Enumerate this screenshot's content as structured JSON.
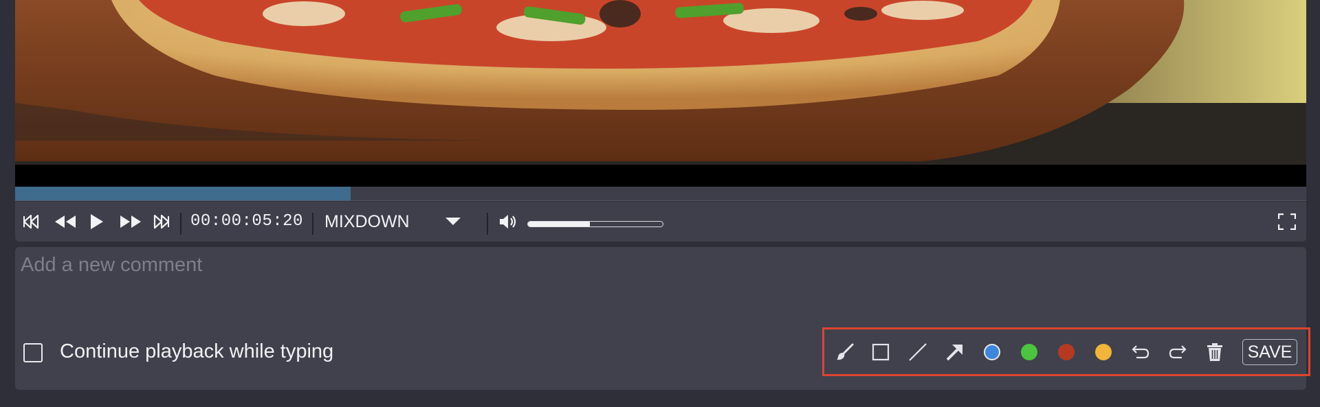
{
  "player": {
    "progress_fraction": 0.26,
    "timecode": "00:00:05:20",
    "audio_track": "MIXDOWN",
    "volume_fraction": 0.46
  },
  "comment": {
    "placeholder": "Add a new comment",
    "continue_playback_label": "Continue playback while typing",
    "continue_playback_checked": false
  },
  "annotation_tools": {
    "tools": [
      "brush-icon",
      "rectangle-icon",
      "line-icon",
      "arrow-icon"
    ],
    "colors": [
      "#3d86d9",
      "#4cc441",
      "#b53a22",
      "#f0b53a"
    ],
    "selected_color": "#3d86d9",
    "undo_icon": "undo-icon",
    "redo_icon": "redo-icon",
    "delete_icon": "trash-icon",
    "save_label": "SAVE"
  },
  "highlight_color": "#e0432e"
}
